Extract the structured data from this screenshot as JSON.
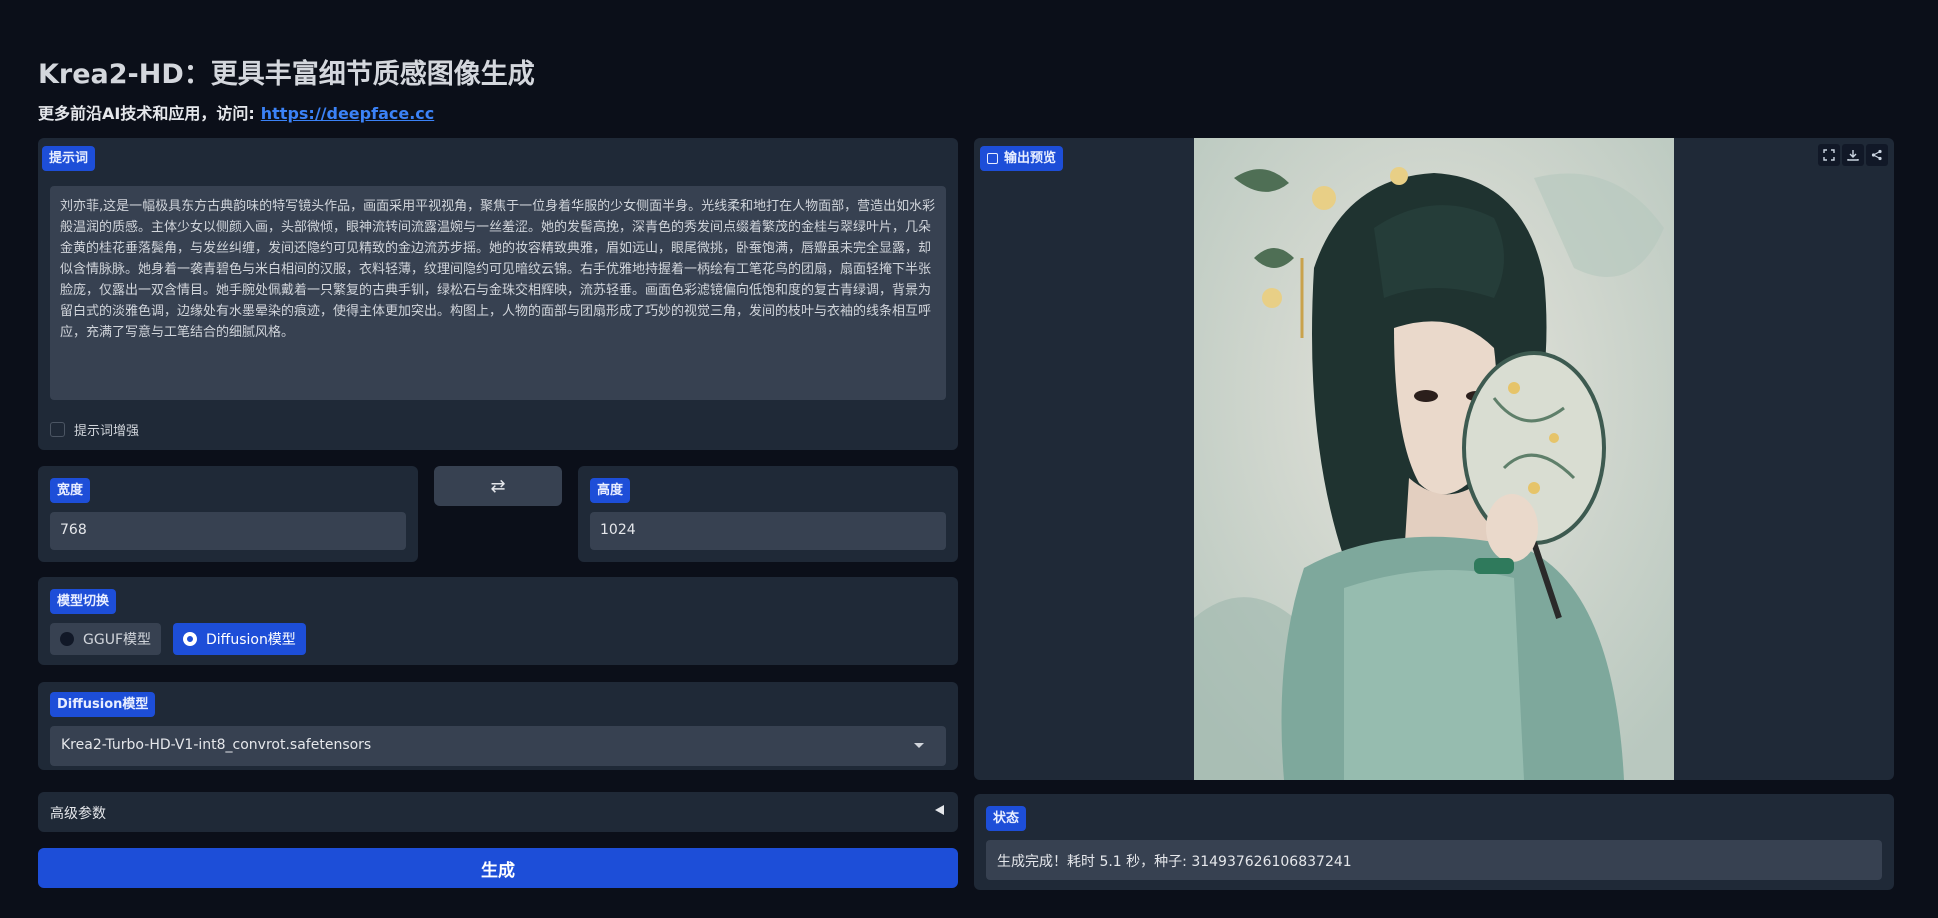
{
  "header": {
    "title": "Krea2-HD：更具丰富细节质感图像生成",
    "subtitle_prefix": "更多前沿AI技术和应用，访问:",
    "link_text": "https://deepface.cc"
  },
  "prompt": {
    "label": "提示词",
    "value": "刘亦菲,这是一幅极具东方古典韵味的特写镜头作品，画面采用平视视角，聚焦于一位身着华服的少女侧面半身。光线柔和地打在人物面部，营造出如水彩般温润的质感。主体少女以侧颜入画，头部微倾，眼神流转间流露温婉与一丝羞涩。她的发髻高挽，深青色的秀发间点缀着繁茂的金桂与翠绿叶片，几朵金黄的桂花垂落鬓角，与发丝纠缠，发间还隐约可见精致的金边流苏步摇。她的妆容精致典雅，眉如远山，眼尾微挑，卧蚕饱满，唇瓣虽未完全显露，却似含情脉脉。她身着一袭青碧色与米白相间的汉服，衣料轻薄，纹理间隐约可见暗纹云锦。右手优雅地持握着一柄绘有工笔花鸟的团扇，扇面轻掩下半张脸庞，仅露出一双含情目。她手腕处佩戴着一只繁复的古典手钏，绿松石与金珠交相辉映，流苏轻垂。画面色彩滤镜偏向低饱和度的复古青绿调，背景为留白式的淡雅色调，边缘处有水墨晕染的痕迹，使得主体更加突出。构图上，人物的面部与团扇形成了巧妙的视觉三角，发间的枝叶与衣袖的线条相互呼应，充满了写意与工笔结合的细腻风格。",
    "enhance_label": "提示词增强"
  },
  "size": {
    "width_label": "宽度",
    "width_value": "768",
    "height_label": "高度",
    "height_value": "1024",
    "swap_symbol": "⇄"
  },
  "model_switch": {
    "label": "模型切换",
    "options": [
      "GGUF模型",
      "Diffusion模型"
    ],
    "selected": "Diffusion模型"
  },
  "diffusion": {
    "label": "Diffusion模型",
    "selected": "Krea2-Turbo-HD-V1-int8_convrot.safetensors"
  },
  "advanced": {
    "label": "高级参数"
  },
  "generate": {
    "label": "生成"
  },
  "output": {
    "label": "输出预览",
    "toolbar": [
      "fullscreen-icon",
      "download-icon",
      "share-icon"
    ]
  },
  "status": {
    "label": "状态",
    "value": "生成完成！耗时 5.1 秒，种子: 314937626106837241"
  },
  "colors": {
    "background": "#0b0f19",
    "panel": "#1f2937",
    "input": "#374151",
    "accent": "#1d4ed8"
  }
}
